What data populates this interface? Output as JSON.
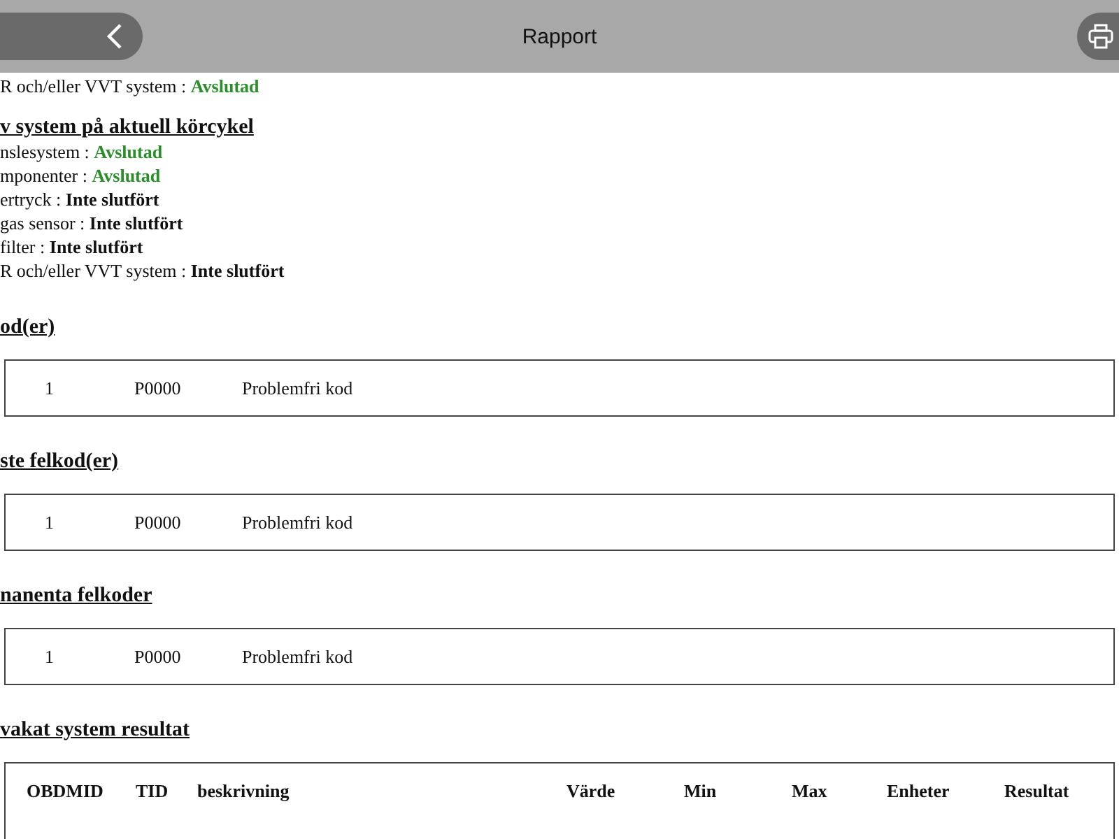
{
  "header": {
    "title": "Rapport"
  },
  "items": [
    {
      "kind": "status",
      "label": "R och/eller VVT system :",
      "value": "Avslutad",
      "complete": true
    },
    {
      "kind": "heading",
      "text": "v system på aktuell körcykel"
    },
    {
      "kind": "status",
      "label": "nslesystem :",
      "value": "Avslutad",
      "complete": true
    },
    {
      "kind": "status",
      "label": "mponenter :",
      "value": "Avslutad",
      "complete": true
    },
    {
      "kind": "status",
      "label": "ertryck :",
      "value": "Inte slutfört",
      "complete": false
    },
    {
      "kind": "status",
      "label": "gas sensor :",
      "value": "Inte slutfört",
      "complete": false
    },
    {
      "kind": "status",
      "label": "filter :",
      "value": "Inte slutfört",
      "complete": false
    },
    {
      "kind": "status",
      "label": "R och/eller VVT system :",
      "value": "Inte slutfört",
      "complete": false
    },
    {
      "kind": "heading",
      "text": "od(er)"
    },
    {
      "kind": "codes",
      "rows": [
        [
          "1",
          "P0000",
          "Problemfri kod"
        ]
      ]
    },
    {
      "kind": "heading",
      "text": "ste felkod(er)"
    },
    {
      "kind": "codes",
      "rows": [
        [
          "1",
          "P0000",
          "Problemfri kod"
        ]
      ]
    },
    {
      "kind": "heading",
      "text": "nanenta felkoder"
    },
    {
      "kind": "codes",
      "rows": [
        [
          "1",
          "P0000",
          "Problemfri kod"
        ]
      ]
    },
    {
      "kind": "heading",
      "text": "vakat system resultat"
    },
    {
      "kind": "table",
      "columns": [
        "OBDMID",
        "TID",
        "beskrivning",
        "Värde",
        "Min",
        "Max",
        "Enheter",
        "Resultat"
      ]
    }
  ]
}
